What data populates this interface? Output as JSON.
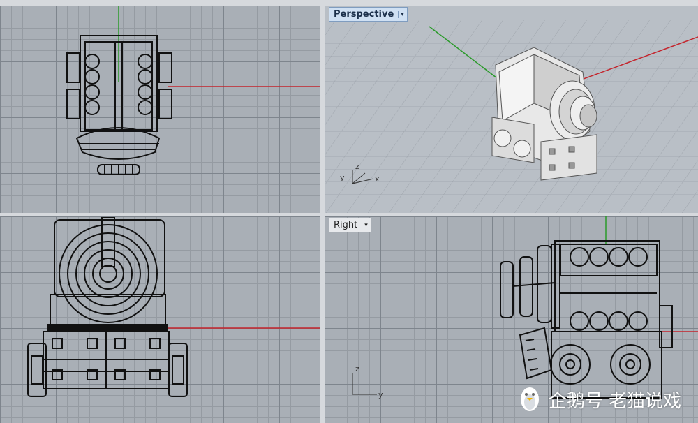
{
  "viewports": {
    "top": {
      "label": ""
    },
    "perspective": {
      "label": "Perspective",
      "menu_arrow": "▾"
    },
    "front": {
      "label": ""
    },
    "right": {
      "label": "Right",
      "menu_arrow": "▾"
    }
  },
  "axes": {
    "persp": {
      "x": "x",
      "y": "y",
      "z": "z"
    },
    "right": {
      "y": "y",
      "z": "z"
    }
  },
  "watermark": {
    "text": "企鹅号 老猫说戏",
    "icon": "penguin-icon"
  },
  "colors": {
    "x_axis": "#c4242c",
    "y_axis": "#2a9a2a",
    "wire": "#111111",
    "grid_major": "#7e858d",
    "grid_minor": "#959ba2"
  }
}
